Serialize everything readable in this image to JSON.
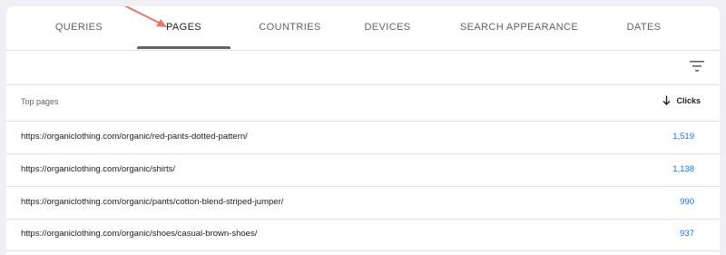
{
  "tabs": [
    {
      "label": "QUERIES",
      "active": false
    },
    {
      "label": "PAGES",
      "active": true
    },
    {
      "label": "COUNTRIES",
      "active": false
    },
    {
      "label": "DEVICES",
      "active": false
    },
    {
      "label": "SEARCH APPEARANCE",
      "active": false
    },
    {
      "label": "DATES",
      "active": false
    }
  ],
  "toolbar": {
    "filter_icon": "filter-icon"
  },
  "table": {
    "column_pages": "Top pages",
    "column_clicks": "Clicks",
    "sort_icon": "arrow-down-icon",
    "rows": [
      {
        "url": "https://organiclothing.com/organic/red-pants-dotted-pattern/",
        "clicks": "1,519"
      },
      {
        "url": "https://organiclothing.com/organic/shirts/",
        "clicks": "1,138"
      },
      {
        "url": "https://organiclothing.com/organic/pants/cotton-blend-striped-jumper/",
        "clicks": "990"
      },
      {
        "url": "https://organiclothing.com/organic/shoes/casual-brown-shoes/",
        "clicks": "937"
      }
    ]
  },
  "colors": {
    "accent_blue": "#1a73e8",
    "annotation_arrow": "#e8776a",
    "tab_indicator": "#5f6368"
  }
}
